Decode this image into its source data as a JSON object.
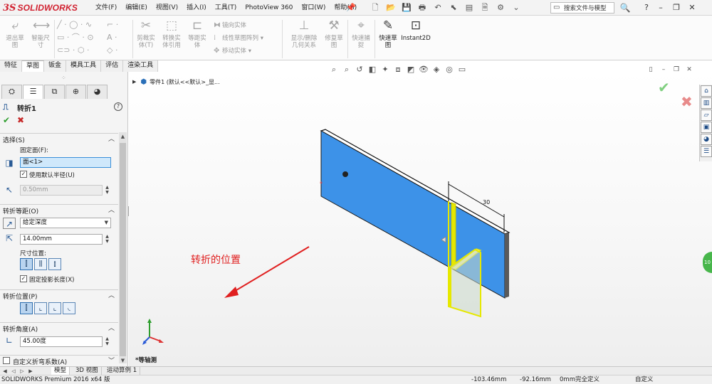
{
  "app": {
    "logo_mark": "3S",
    "brand": "SOLIDWORKS",
    "menus": [
      "文件(F)",
      "编辑(E)",
      "视图(V)",
      "插入(I)",
      "工具(T)",
      "PhotoView 360",
      "窗口(W)",
      "帮助(H)"
    ],
    "search_placeholder": "搜索文件与模型",
    "help": "?"
  },
  "command_manager": {
    "big_buttons": [
      {
        "label": "退出草\n图",
        "icon": "exit-sketch-icon"
      },
      {
        "label": "智能尺\n寸",
        "icon": "smart-dimension-icon"
      },
      {
        "label": "剪裁实\n体(T)",
        "icon": "trim-entities-icon"
      },
      {
        "label": "转换实\n体引用",
        "icon": "convert-entities-icon"
      },
      {
        "label": "等距实\n体",
        "icon": "offset-entities-icon"
      },
      {
        "label": "显示/删除\n几何关系",
        "icon": "display-relations-icon"
      },
      {
        "label": "修复草\n图",
        "icon": "repair-sketch-icon"
      },
      {
        "label": "快速捕\n捉",
        "icon": "quick-snaps-icon"
      },
      {
        "label": "快速草\n图",
        "icon": "rapid-sketch-icon"
      },
      {
        "label": "Instant2D",
        "icon": "instant2d-icon"
      }
    ],
    "text_items": [
      {
        "label": "镜向实体",
        "icon": "mirror-icon"
      },
      {
        "label": "线性草图阵列",
        "icon": "linear-pattern-icon"
      },
      {
        "label": "移动实体",
        "icon": "move-icon"
      }
    ]
  },
  "tabs": [
    {
      "label": "特征",
      "active": false
    },
    {
      "label": "草图",
      "active": true
    },
    {
      "label": "钣金",
      "active": false
    },
    {
      "label": "模具工具",
      "active": false
    },
    {
      "label": "评估",
      "active": false
    },
    {
      "label": "渲染工具",
      "active": false
    }
  ],
  "property_manager": {
    "title": "转折1",
    "help": "?",
    "ok": "✔",
    "cancel": "✖",
    "sections": {
      "selection": {
        "title": "选择(S)",
        "fixed_face_label": "固定面(F):",
        "fixed_face_value": "面<1>",
        "use_default_radius": "使用默认半径(U)",
        "radius": "0.50mm"
      },
      "offset": {
        "title": "转折等距(O)",
        "end_condition": "给定深度",
        "distance": "14.00mm",
        "dim_position_label": "尺寸位置:",
        "fix_projected_length": "固定投影长度(X)"
      },
      "position": {
        "title": "转折位置(P)"
      },
      "angle": {
        "title": "转折角度(A)",
        "value": "45.00度"
      },
      "custom_bend": {
        "label": "自定义折弯系数(A)"
      }
    }
  },
  "viewport": {
    "tree_label": "零件1  (默认<<默认>_显...",
    "annotation": "转折的位置",
    "dimension_text": "30",
    "view_name": "*等轴测",
    "side_tab": "10"
  },
  "bottom_tabs": [
    "模型",
    "3D 视图",
    "运动算例 1"
  ],
  "status": {
    "product": "SOLIDWORKS Premium 2016 x64 版",
    "x": "-103.46mm",
    "y": "-92.16mm",
    "z": "0mm",
    "state": "完全定义",
    "mode": "自定义"
  },
  "colors": {
    "brand_red": "#d1202f",
    "plate_blue": "#3d92e8",
    "selection_yellow": "#e6e800",
    "annotation_red": "#e02020"
  }
}
